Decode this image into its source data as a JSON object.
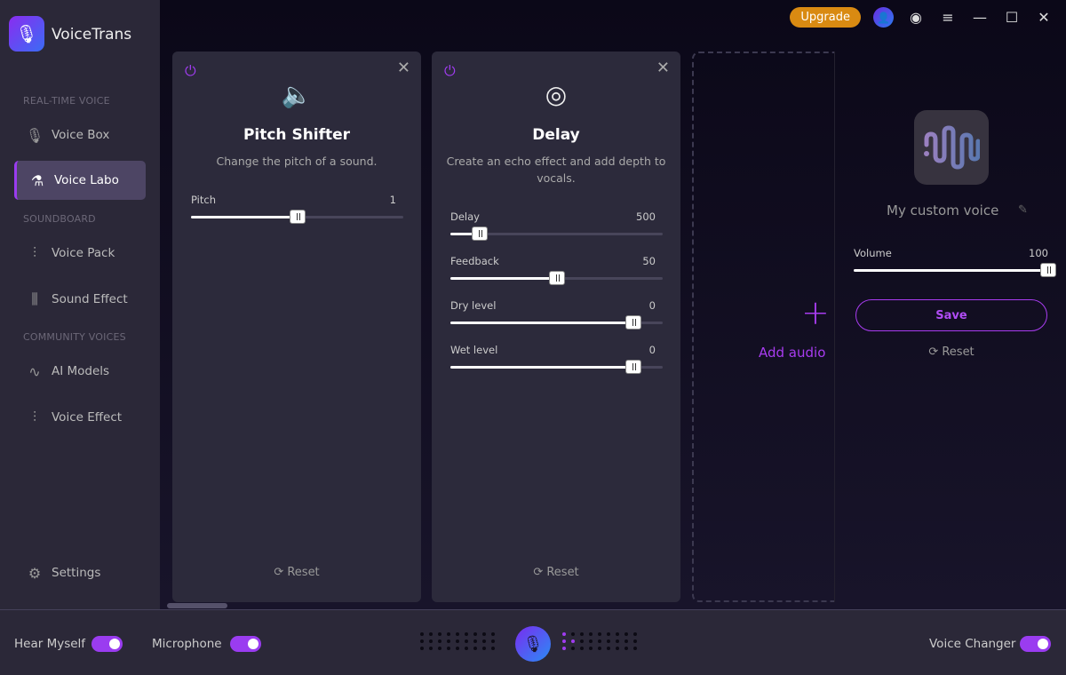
{
  "app": {
    "name": "VoiceTrans"
  },
  "sidebar": {
    "sections": [
      "REAL-TIME VOICE",
      "SOUNDBOARD",
      "COMMUNITY VOICES"
    ],
    "items": [
      {
        "label": "Voice Box",
        "icon": "microphone-icon",
        "active": false
      },
      {
        "label": "Voice Labo",
        "icon": "flask-icon",
        "active": true
      },
      {
        "label": "Voice Pack",
        "icon": "waveform-icon",
        "active": false
      },
      {
        "label": "Sound Effect",
        "icon": "equalizer-icon",
        "active": false
      },
      {
        "label": "AI Models",
        "icon": "wave-icon",
        "active": false
      },
      {
        "label": "Voice Effect",
        "icon": "audio-bars-icon",
        "active": false
      }
    ],
    "settings": "Settings"
  },
  "topbar": {
    "upgrade": "Upgrade"
  },
  "cards": [
    {
      "title": "Pitch Shifter",
      "description": "Change the pitch of a sound.",
      "icon": "speaker-icon",
      "reset": "Reset",
      "params": [
        {
          "label": "Pitch",
          "value": "1",
          "level": 0.5
        }
      ]
    },
    {
      "title": "Delay",
      "description": "Create an echo effect and add depth to vocals.",
      "icon": "echo-icon",
      "reset": "Reset",
      "params": [
        {
          "label": "Delay",
          "value": "500",
          "level": 0.14
        },
        {
          "label": "Feedback",
          "value": "50",
          "level": 0.5
        },
        {
          "label": "Dry level",
          "value": "0",
          "level": 0.86
        },
        {
          "label": "Wet level",
          "value": "0",
          "level": 0.86
        }
      ]
    }
  ],
  "add_audio": "Add audio",
  "voice": {
    "name": "My custom voice",
    "volume_label": "Volume",
    "volume": "100",
    "volume_level": 1.0,
    "save": "Save",
    "reset": "Reset"
  },
  "bottom": {
    "hear_myself": "Hear Myself",
    "microphone": "Microphone",
    "voice_changer": "Voice Changer",
    "hear_myself_on": true,
    "microphone_on": true,
    "voice_changer_on": true
  },
  "colors": {
    "accent": "#9a3cf0",
    "upgrade": "#d98a12"
  }
}
